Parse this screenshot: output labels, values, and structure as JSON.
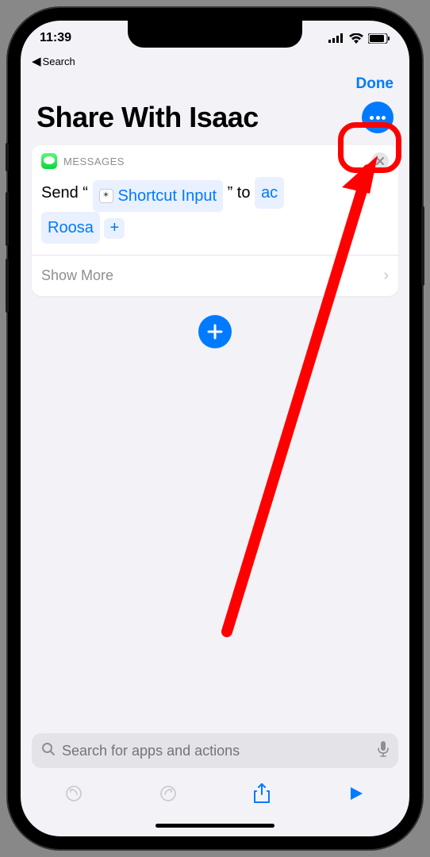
{
  "status": {
    "time": "11:39",
    "back_app_label": "Search"
  },
  "nav": {
    "done_label": "Done"
  },
  "title": "Share With Isaac",
  "action": {
    "app_label": "MESSAGES",
    "prefix": "Send “",
    "input_token": "Shortcut Input",
    "midfix": "” to",
    "recipient": "Isaac Roosa",
    "recipient_obscured_part1": "ac",
    "recipient_obscured_part2": "Roosa",
    "show_more_label": "Show More"
  },
  "search": {
    "placeholder": "Search for apps and actions"
  }
}
